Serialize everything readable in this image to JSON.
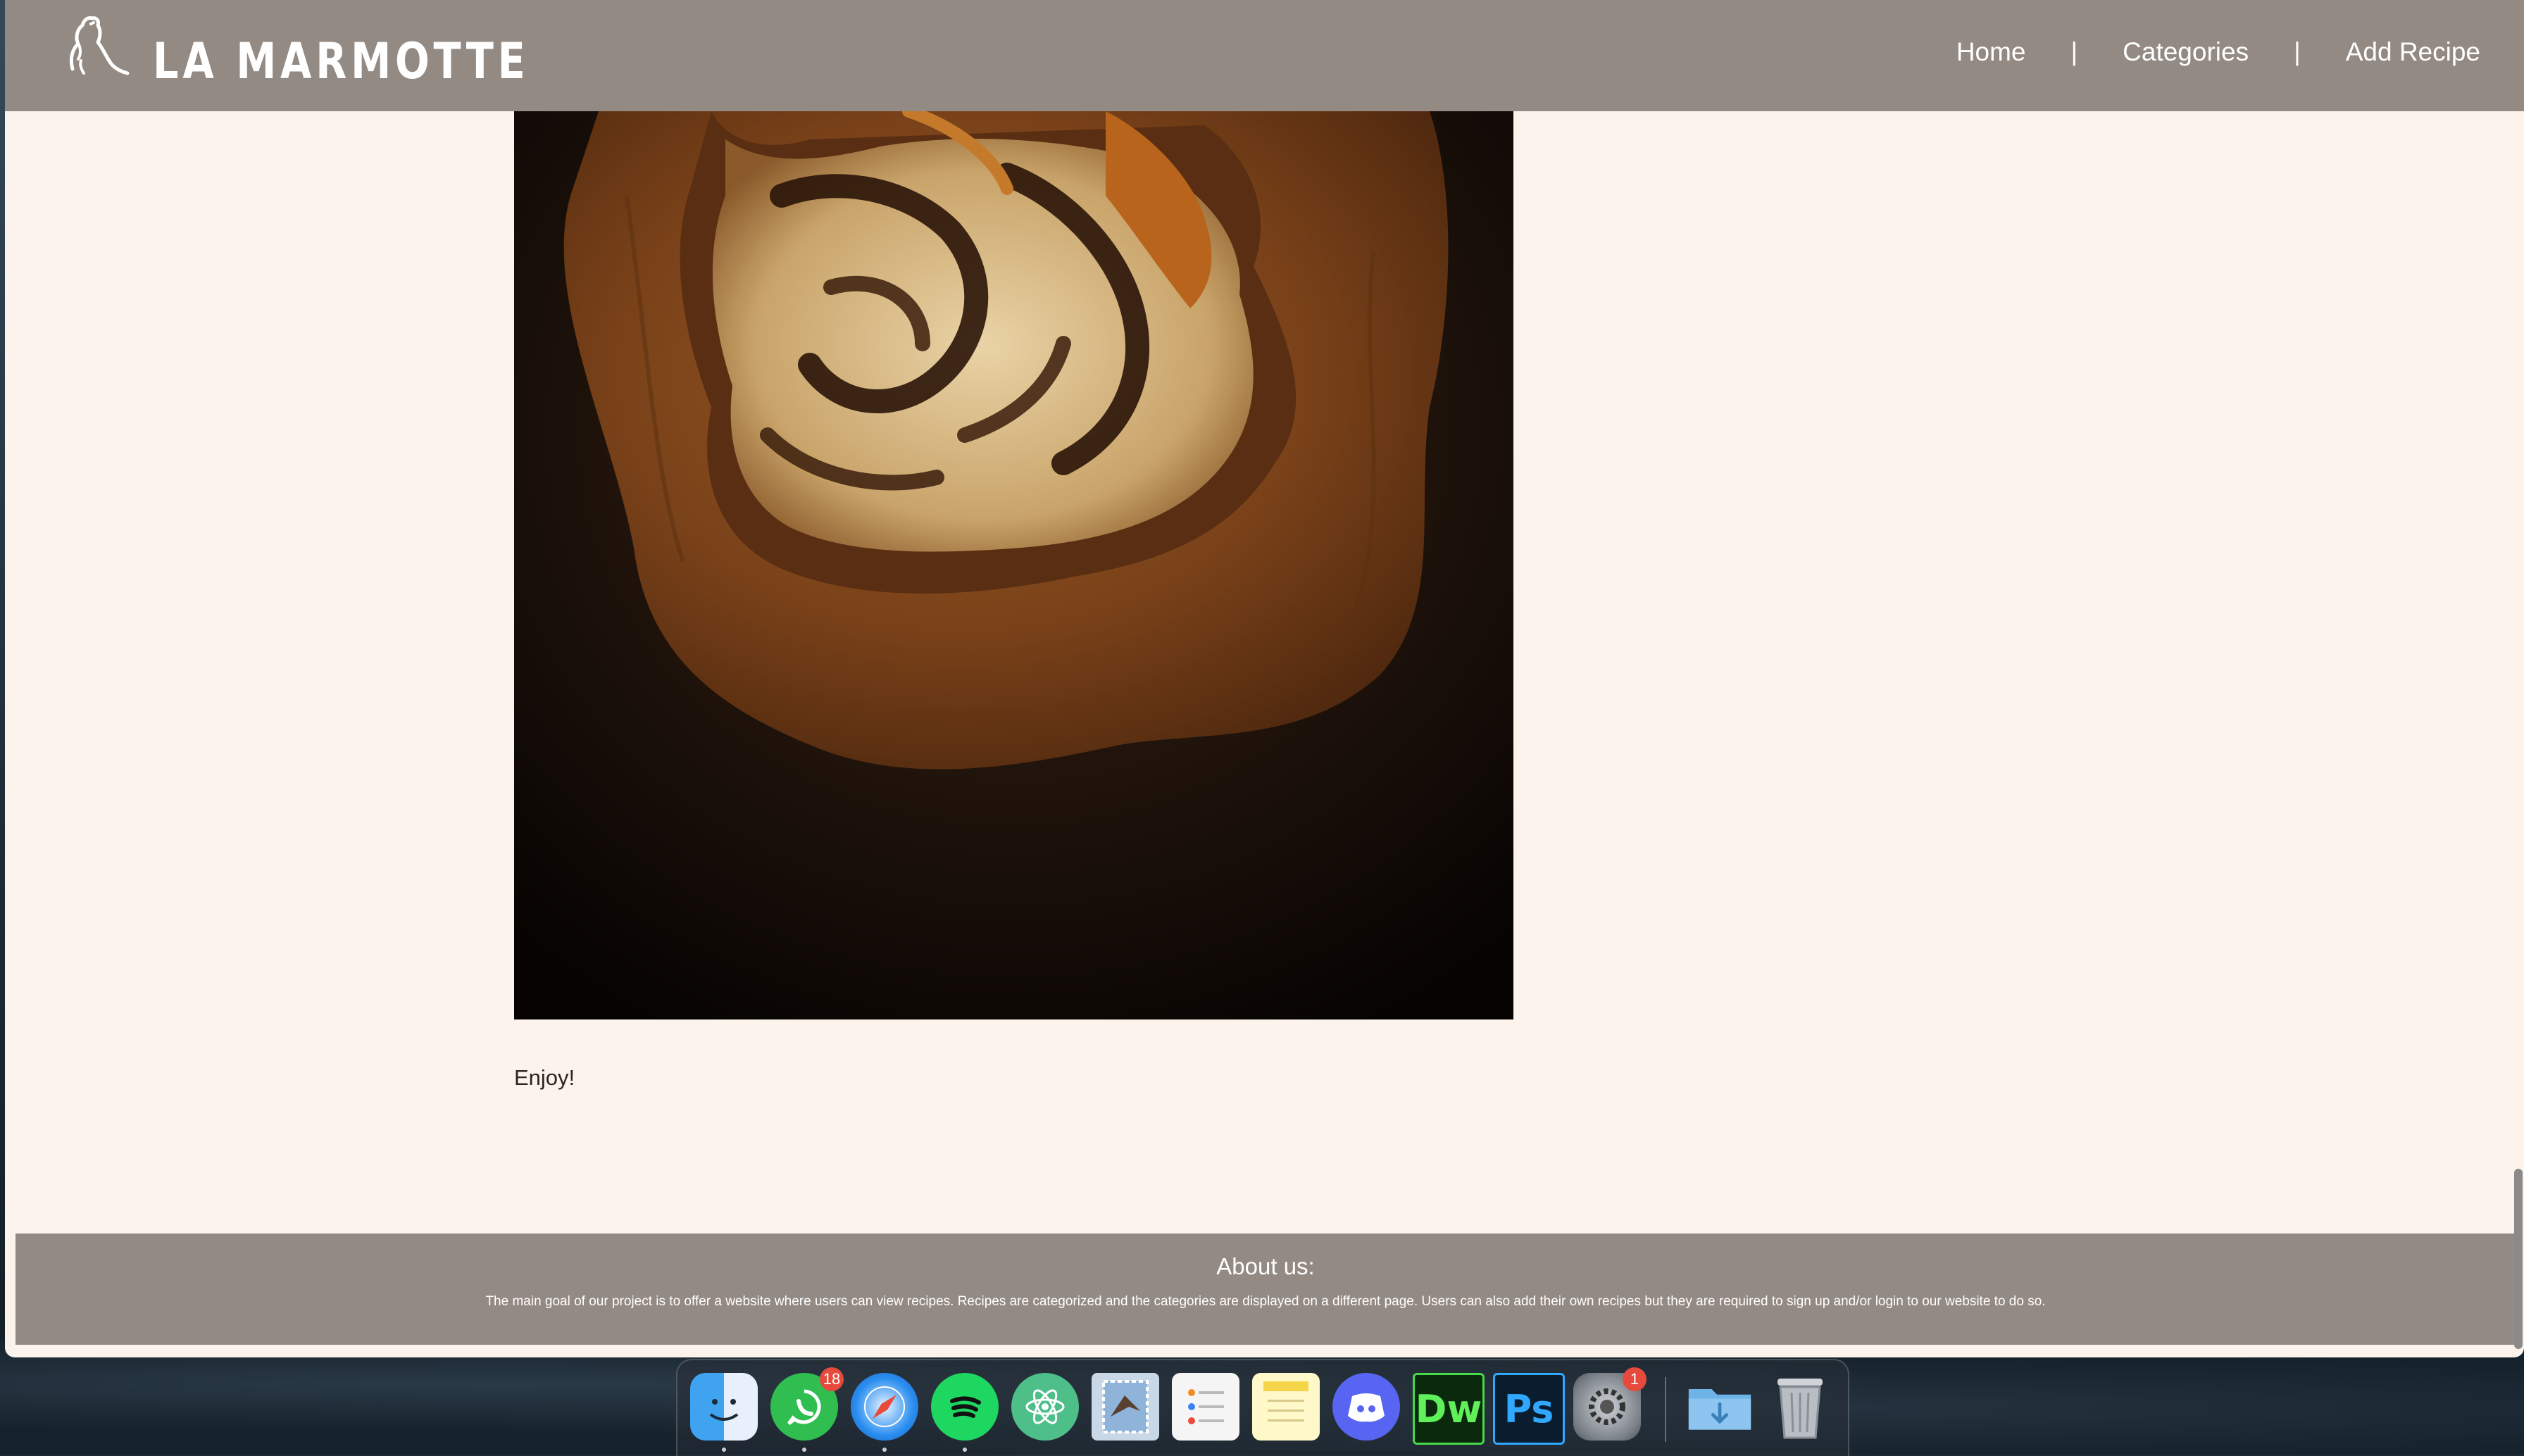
{
  "site": {
    "brand": "LA MARMOTTE",
    "nav": {
      "home": "Home",
      "separator": "|",
      "categories": "Categories",
      "add_recipe": "Add Recipe"
    }
  },
  "content": {
    "closing_text": "Enjoy!"
  },
  "footer": {
    "title": "About us:",
    "text": "The main goal of our project is to offer a website where users can view recipes. Recipes are categorized and the categories are displayed on a different page. Users can also add their own recipes but they are required to sign up and/or login to our website to do so."
  },
  "dock": {
    "items": [
      {
        "name": "finder-icon"
      },
      {
        "name": "whatsapp-icon",
        "badge": "18"
      },
      {
        "name": "safari-icon"
      },
      {
        "name": "spotify-icon"
      },
      {
        "name": "atom-icon"
      },
      {
        "name": "mail-stamp-icon"
      },
      {
        "name": "reminders-icon"
      },
      {
        "name": "notes-icon"
      },
      {
        "name": "discord-icon"
      },
      {
        "name": "dreamweaver-icon",
        "label": "Dw"
      },
      {
        "name": "photoshop-icon",
        "label": "Ps"
      },
      {
        "name": "system-preferences-icon",
        "badge": "1"
      },
      {
        "name": "downloads-folder-icon"
      },
      {
        "name": "trash-icon"
      }
    ]
  },
  "colors": {
    "header_bg": "#938a83",
    "page_bg": "#fcf4ec",
    "footer_bg": "#938a83"
  }
}
